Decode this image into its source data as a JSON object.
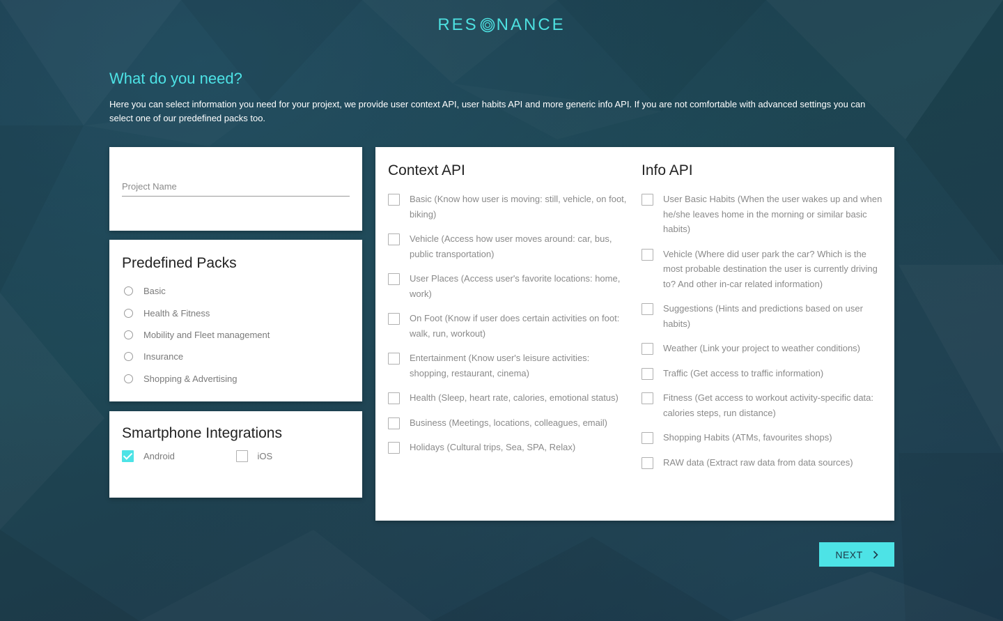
{
  "brand": {
    "logo_text_left": "RES",
    "logo_text_right": "NANCE",
    "accent_color": "#4de3e6"
  },
  "intro": {
    "heading": "What do you need?",
    "description": "Here you can select information you need for your projext, we provide user context API, user habits API and more generic info API. If you are not comfortable with advanced settings you can select one of our predefined packs too."
  },
  "project": {
    "placeholder": "Project Name",
    "value": ""
  },
  "packs": {
    "title": "Predefined Packs",
    "options": [
      {
        "label": "Basic",
        "selected": false
      },
      {
        "label": "Health & Fitness",
        "selected": false
      },
      {
        "label": "Mobility and Fleet management",
        "selected": false
      },
      {
        "label": "Insurance",
        "selected": false
      },
      {
        "label": "Shopping & Advertising",
        "selected": false
      }
    ]
  },
  "integrations": {
    "title": "Smartphone Integrations",
    "options": [
      {
        "label": "Android",
        "checked": true
      },
      {
        "label": "iOS",
        "checked": false
      }
    ]
  },
  "context_api": {
    "title": "Context API",
    "items": [
      {
        "label": "Basic (Know how user is moving: still, vehicle, on foot, biking)",
        "checked": false
      },
      {
        "label": "Vehicle (Access how user moves around: car, bus, public transportation)",
        "checked": false
      },
      {
        "label": "User Places (Access user's favorite locations: home, work)",
        "checked": false
      },
      {
        "label": "On Foot (Know if user does certain activities on foot: walk, run, workout)",
        "checked": false
      },
      {
        "label": "Entertainment (Know user's leisure activities: shopping, restaurant, cinema)",
        "checked": false
      },
      {
        "label": "Health (Sleep, heart rate, calories, emotional status)",
        "checked": false
      },
      {
        "label": "Business (Meetings, locations, colleagues, email)",
        "checked": false
      },
      {
        "label": "Holidays (Cultural trips, Sea, SPA, Relax)",
        "checked": false
      }
    ]
  },
  "info_api": {
    "title": "Info API",
    "items": [
      {
        "label": "User Basic Habits (When the user wakes up and when he/she leaves home in the morning or similar basic habits)",
        "checked": false
      },
      {
        "label": "Vehicle (Where did user park the car? Which is the most probable destination the user is currently driving to? And other in-car related information)",
        "checked": false
      },
      {
        "label": "Suggestions (Hints and predictions based on user habits)",
        "checked": false
      },
      {
        "label": "Weather (Link your project to weather conditions)",
        "checked": false
      },
      {
        "label": "Traffic (Get access to traffic information)",
        "checked": false
      },
      {
        "label": "Fitness (Get access to workout activity-specific data: calories steps, run distance)",
        "checked": false
      },
      {
        "label": "Shopping Habits (ATMs, favourites shops)",
        "checked": false
      },
      {
        "label": "RAW data (Extract raw data from data sources)",
        "checked": false
      }
    ]
  },
  "footer": {
    "next_label": "NEXT"
  }
}
